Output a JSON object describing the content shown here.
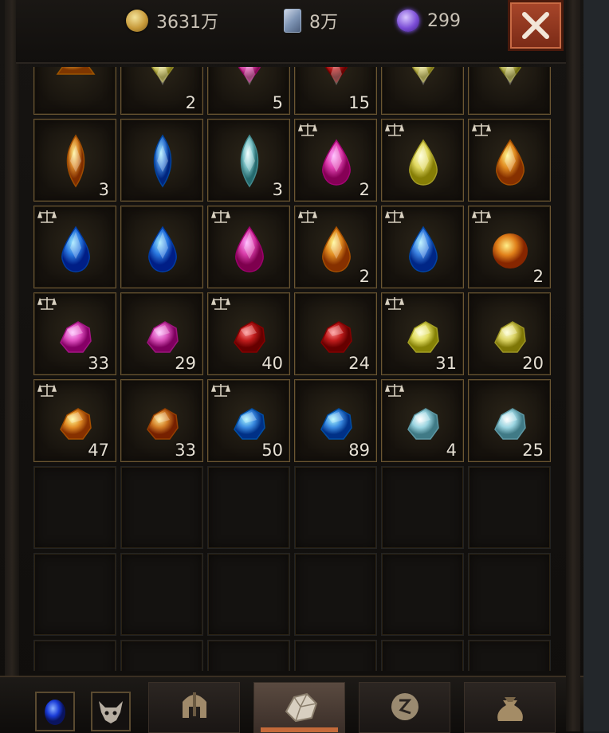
{
  "currencies": {
    "gold": {
      "icon": "gold-coin-icon",
      "value": "3631万"
    },
    "cards": {
      "icon": "card-icon",
      "value": "8万"
    },
    "orbs": {
      "icon": "purple-orb-icon",
      "value": "299"
    }
  },
  "close_icon": "close-icon",
  "inventory": {
    "rows": [
      [
        {
          "gem": "yellow-triangle-gem-icon",
          "color": "#d8902a",
          "shape": "tri",
          "count": "",
          "scale": false
        },
        {
          "gem": "yellow-gem-icon",
          "color": "#c9c265",
          "shape": "shield",
          "count": "2",
          "scale": false
        },
        {
          "gem": "pink-gem-icon",
          "color": "#d044a0",
          "shape": "shield",
          "count": "5",
          "scale": false
        },
        {
          "gem": "red-gem-icon",
          "color": "#b01818",
          "shape": "shield",
          "count": "15",
          "scale": false
        },
        {
          "gem": "yellow-gem-icon",
          "color": "#c9c265",
          "shape": "shield",
          "count": "",
          "scale": false
        },
        {
          "gem": "yellow-gem-icon",
          "color": "#b8b45a",
          "shape": "shield",
          "count": "",
          "scale": false
        }
      ],
      [
        {
          "gem": "orange-marquise-gem-icon",
          "color": "#d8872a",
          "shape": "marquise",
          "count": "3",
          "scale": false
        },
        {
          "gem": "blue-marquise-gem-icon",
          "color": "#3a7fd8",
          "shape": "marquise",
          "count": "",
          "scale": false
        },
        {
          "gem": "teal-marquise-gem-icon",
          "color": "#7fc4c8",
          "shape": "marquise",
          "count": "3",
          "scale": false
        },
        {
          "gem": "pink-teardrop-gem-icon",
          "color": "#e040b0",
          "shape": "tear",
          "count": "2",
          "scale": true
        },
        {
          "gem": "yellow-teardrop-gem-icon",
          "color": "#e0d860",
          "shape": "tear",
          "count": "",
          "scale": true
        },
        {
          "gem": "orange-teardrop-gem-icon",
          "color": "#e08a20",
          "shape": "tear",
          "count": "",
          "scale": true
        }
      ],
      [
        {
          "gem": "blue-teardrop-gem-icon",
          "color": "#2a78e0",
          "shape": "tear",
          "count": "",
          "scale": true
        },
        {
          "gem": "blue-teardrop-gem-icon",
          "color": "#2a78e0",
          "shape": "tear",
          "count": "",
          "scale": false
        },
        {
          "gem": "pink-teardrop-gem-icon",
          "color": "#d83ca8",
          "shape": "tear",
          "count": "",
          "scale": true
        },
        {
          "gem": "orange-teardrop-gem-icon",
          "color": "#e08a20",
          "shape": "tear",
          "count": "2",
          "scale": true
        },
        {
          "gem": "blue-teardrop-gem-icon",
          "color": "#3a80e0",
          "shape": "tear",
          "count": "",
          "scale": true
        },
        {
          "gem": "amber-orb-gem-icon",
          "color": "#e0801a",
          "shape": "orb",
          "count": "2",
          "scale": true
        }
      ],
      [
        {
          "gem": "pink-rough-gem-icon",
          "color": "#e050c0",
          "shape": "rough",
          "count": "33",
          "scale": true
        },
        {
          "gem": "pink-rough-gem-icon",
          "color": "#d850b8",
          "shape": "rough",
          "count": "29",
          "scale": false
        },
        {
          "gem": "red-rough-gem-icon",
          "color": "#c01c1c",
          "shape": "rough",
          "count": "40",
          "scale": true
        },
        {
          "gem": "red-rough-gem-icon",
          "color": "#c01c1c",
          "shape": "rough",
          "count": "24",
          "scale": false
        },
        {
          "gem": "yellow-rough-gem-icon",
          "color": "#e0dc60",
          "shape": "rough",
          "count": "31",
          "scale": true
        },
        {
          "gem": "yellow-rough-gem-icon",
          "color": "#d8d060",
          "shape": "rough",
          "count": "20",
          "scale": false
        }
      ],
      [
        {
          "gem": "orange-rough-gem-icon",
          "color": "#e08a24",
          "shape": "rough",
          "count": "47",
          "scale": true
        },
        {
          "gem": "orange-rough-gem-icon",
          "color": "#d07a24",
          "shape": "rough",
          "count": "33",
          "scale": false
        },
        {
          "gem": "blue-rough-gem-icon",
          "color": "#3a8ae0",
          "shape": "rough",
          "count": "50",
          "scale": true
        },
        {
          "gem": "blue-rough-gem-icon",
          "color": "#3a8ae0",
          "shape": "rough",
          "count": "89",
          "scale": false
        },
        {
          "gem": "teal-rough-gem-icon",
          "color": "#9ad4e0",
          "shape": "rough",
          "count": "4",
          "scale": true
        },
        {
          "gem": "teal-rough-gem-icon",
          "color": "#9ad4e0",
          "shape": "rough",
          "count": "25",
          "scale": false
        }
      ]
    ],
    "empty_rows": 3
  },
  "bottom_bar": {
    "slots": [
      {
        "icon": "blue-orb-icon"
      },
      {
        "icon": "demon-face-icon"
      }
    ],
    "tabs": [
      {
        "icon": "helmet-icon",
        "active": false
      },
      {
        "icon": "gem-tab-icon",
        "active": true
      },
      {
        "icon": "rune-icon",
        "active": false
      },
      {
        "icon": "bag-icon",
        "active": false
      }
    ]
  }
}
